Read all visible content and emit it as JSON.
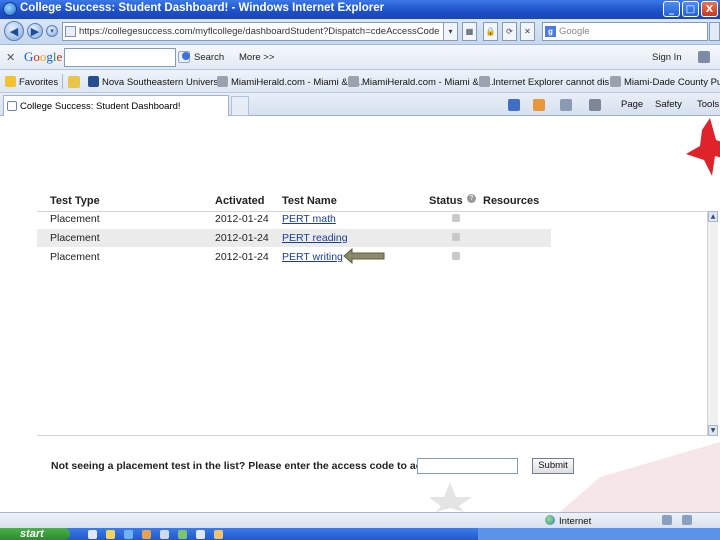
{
  "window": {
    "title": "College Success: Student Dashboard! - Windows Internet Explorer",
    "min": "_",
    "max": "□",
    "close": "X"
  },
  "address": {
    "url": "https://collegesuccess.com/myflcollege/dashboardStudent?Dispatch=cdeAccessCode",
    "search_placeholder": "Google"
  },
  "google_toolbar": {
    "logo": [
      "G",
      "o",
      "o",
      "g",
      "l",
      "e"
    ],
    "search_label": "Search",
    "more_label": "More >>",
    "signin_label": "Sign In"
  },
  "favorites": {
    "label": "Favorites",
    "items": [
      "Nova Southeastern University",
      "MiamiHerald.com - Miami & F...",
      "MiamiHerald.com - Miami & F...",
      "Internet Explorer cannot dis...",
      "Miami-Dade County Public"
    ]
  },
  "tab": {
    "label": "College Success: Student Dashboard!"
  },
  "commandbar": {
    "page": "Page",
    "safety": "Safety",
    "tools": "Tools"
  },
  "table": {
    "headers": {
      "type": "Test Type",
      "activated": "Activated",
      "name": "Test Name",
      "status": "Status",
      "resources": "Resources"
    },
    "rows": [
      {
        "type": "Placement",
        "activated": "2012-01-24",
        "name": "PERT math"
      },
      {
        "type": "Placement",
        "activated": "2012-01-24",
        "name": "PERT reading"
      },
      {
        "type": "Placement",
        "activated": "2012-01-24",
        "name": "PERT writing"
      }
    ]
  },
  "access_code": {
    "prompt": "Not seeing a placement test in the list? Please enter the access code to activate it:",
    "value": "",
    "submit_label": "Submit"
  },
  "statusbar": {
    "zone": "Internet"
  },
  "taskbar": {
    "start_label": "start"
  },
  "colors": {
    "titlebar": "#1c4fc8",
    "link": "#1a3e96",
    "arrow": "#8a8a6a",
    "star_red": "#e0222b"
  }
}
